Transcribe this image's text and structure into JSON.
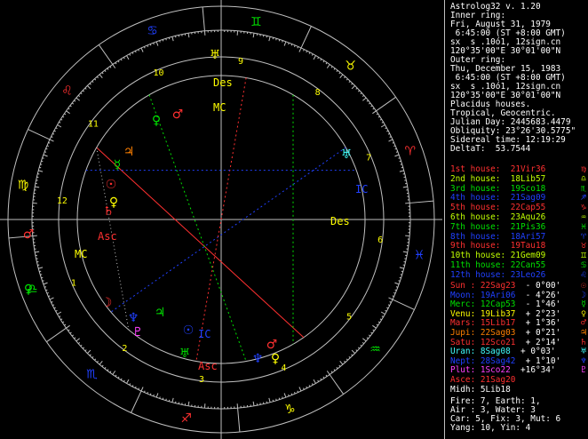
{
  "colors": {
    "white": "#ffffff",
    "red": "#ff3030",
    "green": "#00e000",
    "lime": "#c0ff00",
    "yellow": "#ffff00",
    "blue": "#2040ff",
    "cyan": "#40ffff",
    "orange": "#ff8000",
    "magenta": "#ff40ff",
    "gray": "#a0a0a0"
  },
  "info": {
    "title": "Astrolog32 v. 1.20",
    "inner_label": "Inner ring:",
    "inner_date": "Fri, August 31, 1979",
    "inner_time": " 6:45:00 (ST +8:00 GMT)",
    "inner_place": "sx  s .10ó1, 12sign.cn",
    "inner_coords": "120°35'00\"E 30°01'00\"N",
    "outer_label": "Outer ring:",
    "outer_date": "Thu, December 15, 1983",
    "outer_time": " 6:45:00 (ST +8:00 GMT)",
    "outer_place": "sx  s .10ó1, 12sign.cn",
    "outer_coords": "120°35'00\"E 30°01'00\"N",
    "house_system": "Placidus houses.",
    "zodiac": "Tropical, Geocentric.",
    "julian": "Julian Day: 2445683.4479",
    "obliquity": "Obliquity: 23°26'30.5775\"",
    "sidereal": "Sidereal time: 12:19:29",
    "deltat": "DeltaT:  53.7544"
  },
  "houses": [
    {
      "label": "1st house:",
      "value": "21Vir36",
      "color": "#ff3030",
      "glyph": "♍"
    },
    {
      "label": "2nd house:",
      "value": "18Lib57",
      "color": "#c0ff00",
      "glyph": "♎"
    },
    {
      "label": "3rd house:",
      "value": "19Sco18",
      "color": "#00e000",
      "glyph": "♏"
    },
    {
      "label": "4th house:",
      "value": "21Sag09",
      "color": "#2040ff",
      "glyph": "♐"
    },
    {
      "label": "5th house:",
      "value": "22Cap55",
      "color": "#ff3030",
      "glyph": "♑"
    },
    {
      "label": "6th house:",
      "value": "23Aqu26",
      "color": "#c0ff00",
      "glyph": "♒"
    },
    {
      "label": "7th house:",
      "value": "21Pis36",
      "color": "#00e000",
      "glyph": "♓"
    },
    {
      "label": "8th house:",
      "value": "18Ari57",
      "color": "#2040ff",
      "glyph": "♈"
    },
    {
      "label": "9th house:",
      "value": "19Tau18",
      "color": "#ff3030",
      "glyph": "♉"
    },
    {
      "label": "10th house:",
      "value": "21Gem09",
      "color": "#c0ff00",
      "glyph": "♊"
    },
    {
      "label": "11th house:",
      "value": "22Can55",
      "color": "#00e000",
      "glyph": "♋"
    },
    {
      "label": "12th house:",
      "value": "23Leo26",
      "color": "#2040ff",
      "glyph": "♌"
    }
  ],
  "planets": [
    {
      "label": "Sun :",
      "value": "22Sag23",
      "motion": "- 0°00'",
      "color": "#ff3030",
      "glyph": "☉"
    },
    {
      "label": "Moon:",
      "value": "19Ari06",
      "motion": "- 4°26'",
      "color": "#2040ff",
      "glyph": "☽"
    },
    {
      "label": "Merc:",
      "value": "12Cap53",
      "motion": "- 1°46'",
      "color": "#00e000",
      "glyph": "☿"
    },
    {
      "label": "Venu:",
      "value": "19Lib37",
      "motion": "+ 2°23'",
      "color": "#ffff00",
      "glyph": "♀"
    },
    {
      "label": "Mars:",
      "value": "15Lib17",
      "motion": "+ 1°36'",
      "color": "#ff3030",
      "glyph": "♂"
    },
    {
      "label": "Jupi:",
      "value": "22Sag03",
      "motion": "+ 0°21'",
      "color": "#ff8000",
      "glyph": "♃"
    },
    {
      "label": "Satu:",
      "value": "12Sco21",
      "motion": "+ 2°14'",
      "color": "#ff3030",
      "glyph": "♄"
    },
    {
      "label": "Uran:",
      "value": "8Sag08",
      "motion": "+ 0°03'",
      "color": "#40ffff",
      "glyph": "♅"
    },
    {
      "label": "Nept:",
      "value": "28Sag42",
      "motion": "+ 1°10'",
      "color": "#2040ff",
      "glyph": "♆"
    },
    {
      "label": "Plut:",
      "value": "1Sco22",
      "motion": "+16°34'",
      "color": "#ff40ff",
      "glyph": "♇"
    },
    {
      "label": "Asce:",
      "value": "21Sag20",
      "motion": "",
      "color": "#ff3030",
      "glyph": ""
    },
    {
      "label": "Midh:",
      "value": "5Lib18",
      "motion": "",
      "color": "#ffffff",
      "glyph": ""
    }
  ],
  "elements": {
    "line1": "Fire: 7, Earth: 1,",
    "line2": "Air : 3, Water: 3",
    "line3": "Car: 5, Fix: 3, Mut: 6",
    "line4": "Yang: 10, Yin: 4"
  },
  "wheel": {
    "signs": [
      {
        "glyph": "♈",
        "color": "#ff3030"
      },
      {
        "glyph": "♉",
        "color": "#ffff00"
      },
      {
        "glyph": "♊",
        "color": "#00e000"
      },
      {
        "glyph": "♋",
        "color": "#2040ff"
      },
      {
        "glyph": "♌",
        "color": "#ff3030"
      },
      {
        "glyph": "♍",
        "color": "#ffff00"
      },
      {
        "glyph": "♎",
        "color": "#00e000"
      },
      {
        "glyph": "♏",
        "color": "#2040ff"
      },
      {
        "glyph": "♐",
        "color": "#ff3030"
      },
      {
        "glyph": "♑",
        "color": "#ffff00"
      },
      {
        "glyph": "♒",
        "color": "#00e000"
      },
      {
        "glyph": "♓",
        "color": "#2040ff"
      }
    ],
    "house_numbers": [
      "1",
      "2",
      "3",
      "4",
      "5",
      "6",
      "7",
      "8",
      "9",
      "10",
      "11",
      "12"
    ],
    "angle_labels": {
      "asc": "Asc",
      "des": "Des",
      "mc": "MC",
      "ic": "IC"
    }
  }
}
